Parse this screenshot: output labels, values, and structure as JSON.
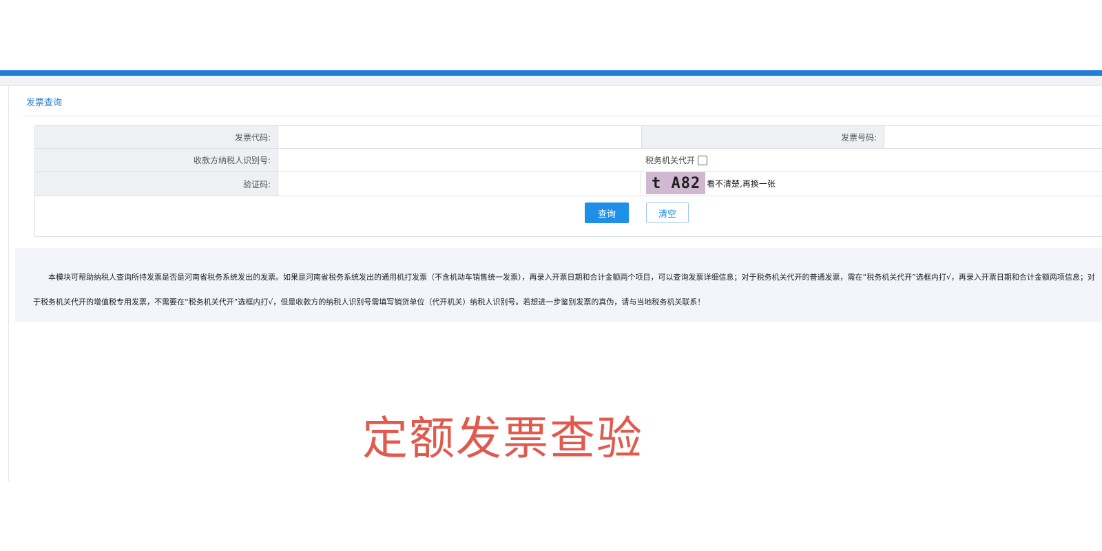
{
  "breadcrumb": "发票查询",
  "form": {
    "invoice_code_label": "发票代码:",
    "invoice_number_label": "发票号码:",
    "payee_tax_id_label": "收款方纳税人识别号:",
    "tax_agency_issued_label": "税务机关代开",
    "captcha_label": "验证码:",
    "captcha_text": "t A82",
    "refresh_text": "看不清楚,再换一张"
  },
  "buttons": {
    "query": "查询",
    "clear": "清空"
  },
  "note": "本模块可帮助纳税人查询所持发票是否是河南省税务系统发出的发票。如果是河南省税务系统发出的通用机打发票（不含机动车销售统一发票），再录入开票日期和合计金额两个项目，可以查询发票详细信息；对于税务机关代开的普通发票，需在“税务机关代开”选框内打√，再录入开票日期和合计金额两项信息；对于税务机关代开的增值税专用发票，不需要在“税务机关代开”选框内打√，但是收款方的纳税人识别号需填写销货单位（代开机关）纳税人识别号。若想进一步鉴别发票的真伪，请与当地税务机关联系！",
  "overlay_title": "定额发票查验"
}
